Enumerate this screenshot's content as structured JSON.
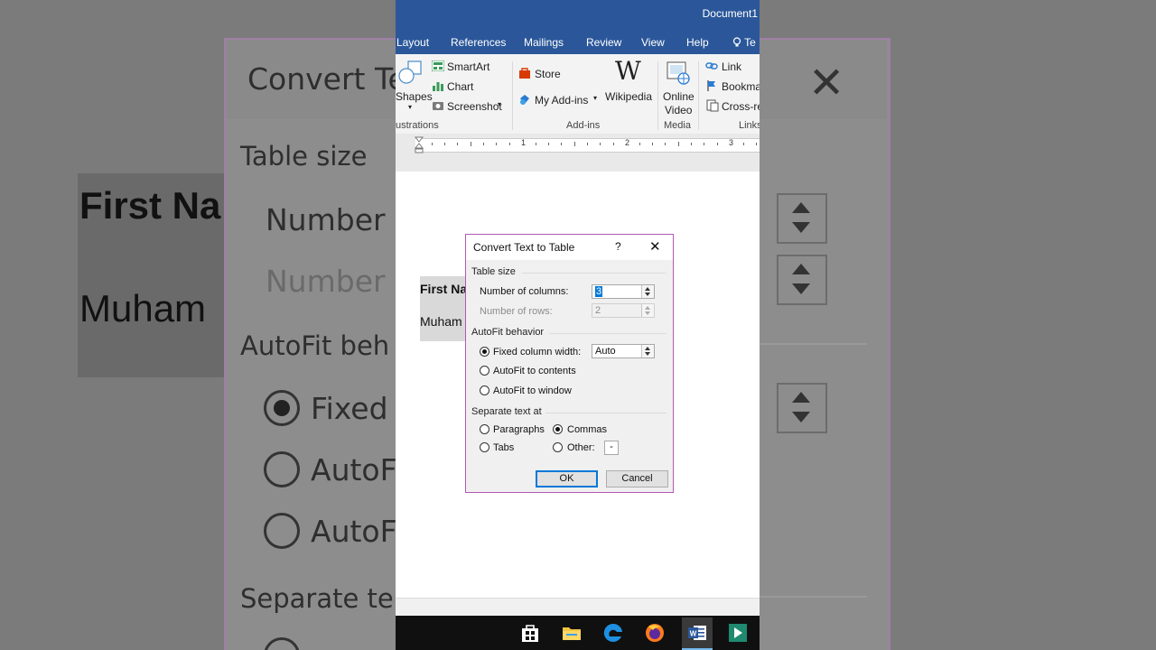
{
  "background": {
    "title": "Convert Te",
    "table_size": "Table size",
    "num_columns": "Number c",
    "num_rows": "Number c",
    "autofit": "AutoFit beh",
    "fixed": "Fixed c",
    "autofit1": "AutoF",
    "autofit2": "AutoF",
    "separate": "Separate te",
    "doc_first": "First Na",
    "doc_second": "Muham"
  },
  "window": {
    "doc_title": "Document1"
  },
  "tabs": [
    "Layout",
    "References",
    "Mailings",
    "Review",
    "View",
    "Help",
    "Te"
  ],
  "ribbon": {
    "shapes": "Shapes",
    "smartart": "SmartArt",
    "chart": "Chart",
    "screenshot": "Screenshot",
    "illustrations": "ustrations",
    "store": "Store",
    "my_addins": "My Add-ins",
    "wikipedia": "Wikipedia",
    "addins_group": "Add-ins",
    "online_video_1": "Online",
    "online_video_2": "Video",
    "media_group": "Media",
    "link": "Link",
    "bookmark": "Bookmar",
    "crossref": "Cross-re",
    "links_group": "Links"
  },
  "ruler": [
    "1",
    "2",
    "3"
  ],
  "document": {
    "cell1": "First Na",
    "cell2": "Muham"
  },
  "dialog": {
    "title": "Convert Text to Table",
    "help": "?",
    "close": "✕",
    "table_size": "Table size",
    "num_columns_label": "Number of columns:",
    "num_columns_value": "3",
    "num_rows_label": "Number of rows:",
    "num_rows_value": "2",
    "autofit_behavior": "AutoFit behavior",
    "fixed_width_label": "Fixed column width:",
    "fixed_width_value": "Auto",
    "autofit_contents": "AutoFit to contents",
    "autofit_window": "AutoFit to window",
    "separate_at": "Separate text at",
    "paragraphs": "Paragraphs",
    "commas": "Commas",
    "tabs": "Tabs",
    "other": "Other:",
    "other_value": "-",
    "ok": "OK",
    "cancel": "Cancel"
  },
  "colors": {
    "accent": "#2b579a",
    "dialog_border": "#b25ab0",
    "default_button": "#0078d7"
  }
}
